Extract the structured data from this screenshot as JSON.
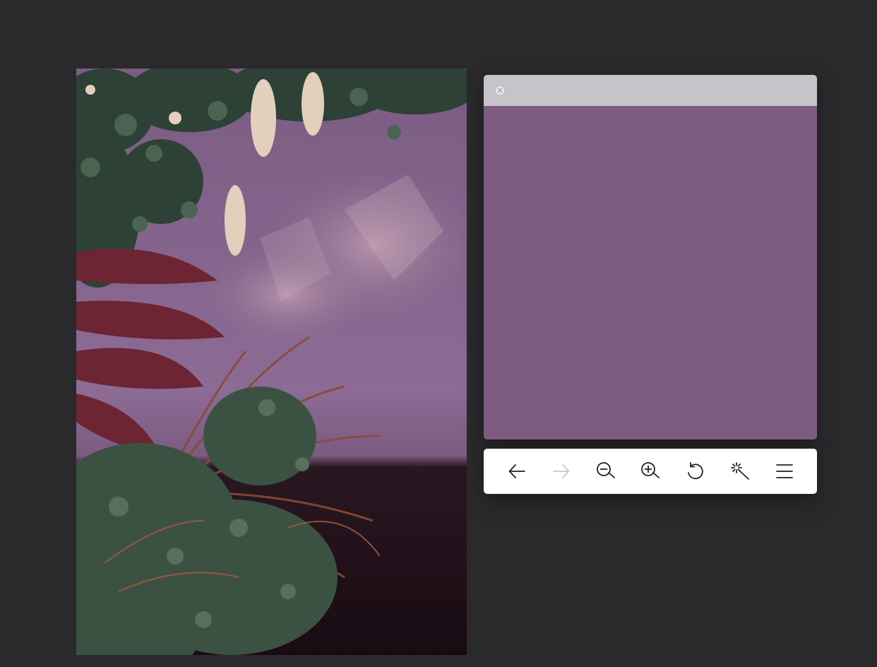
{
  "photo": {
    "icon": "floral-photo",
    "colors": {
      "backdrop": "#8a6593",
      "floor": "#1c0f17",
      "foliage_dark": "#2d4136",
      "foliage_sage": "#4a6451",
      "leaf_burgundy": "#6d2433",
      "grass_rust": "#8a4a32",
      "blossom": "#e2cfbc"
    }
  },
  "swatch_window": {
    "swatch_color": "#7e5b80",
    "titlebar_color": "#c6c4c9",
    "close_icon": "close-icon"
  },
  "toolbar": {
    "background": "#ffffff",
    "tools": [
      {
        "icon": "back-arrow-icon",
        "enabled": true
      },
      {
        "icon": "forward-arrow-icon",
        "enabled": false
      },
      {
        "icon": "zoom-out-icon",
        "enabled": true
      },
      {
        "icon": "zoom-in-icon",
        "enabled": true
      },
      {
        "icon": "rotate-icon",
        "enabled": true
      },
      {
        "icon": "magic-wand-icon",
        "enabled": true
      },
      {
        "icon": "menu-icon",
        "enabled": true
      }
    ]
  }
}
